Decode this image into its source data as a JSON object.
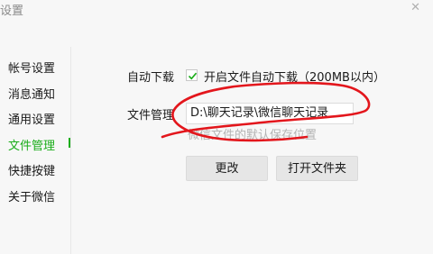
{
  "window": {
    "title": "设置",
    "close_label": "✕"
  },
  "sidebar": {
    "items": [
      {
        "label": "帐号设置",
        "active": false
      },
      {
        "label": "消息通知",
        "active": false
      },
      {
        "label": "通用设置",
        "active": false
      },
      {
        "label": "文件管理",
        "active": true
      },
      {
        "label": "快捷按键",
        "active": false
      },
      {
        "label": "关于微信",
        "active": false
      }
    ]
  },
  "colors": {
    "accent": "#1aad19",
    "annotation": "#e3161c",
    "hint_text": "#b4b4b4"
  },
  "auto_download": {
    "label": "自动下载",
    "checkbox_checked": true,
    "checkbox_text": "开启文件自动下载（200MB以内）"
  },
  "file_management": {
    "label": "文件管理",
    "path": "D:\\聊天记录\\微信聊天记录",
    "hint": "微信文件的默认保存位置"
  },
  "buttons": {
    "change": "更改",
    "open_folder": "打开文件夹"
  },
  "annotation": {
    "type": "hand-drawn red circle around file path"
  }
}
